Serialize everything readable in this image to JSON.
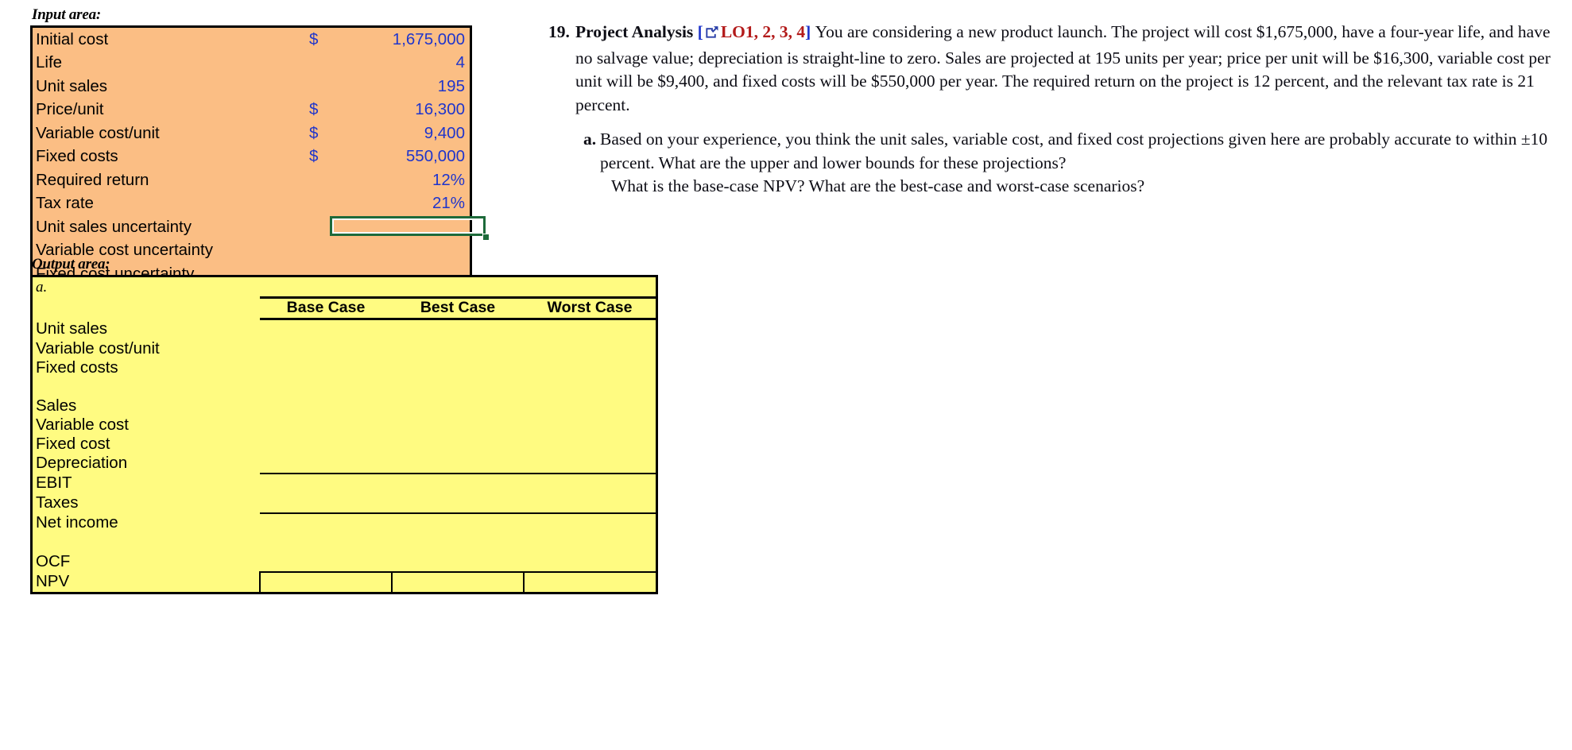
{
  "input_area": {
    "title": "Input area:",
    "fill_color": "#FBBE84",
    "value_color": "#1F35CC",
    "rows": [
      {
        "label": "Initial cost",
        "currency": "$",
        "value": "1,675,000"
      },
      {
        "label": "Life",
        "currency": "",
        "value": "4"
      },
      {
        "label": "Unit sales",
        "currency": "",
        "value": "195"
      },
      {
        "label": "Price/unit",
        "currency": "$",
        "value": "16,300"
      },
      {
        "label": "Variable cost/unit",
        "currency": "$",
        "value": "9,400"
      },
      {
        "label": "Fixed costs",
        "currency": "$",
        "value": "550,000"
      },
      {
        "label": "Required return",
        "currency": "",
        "value": "12%"
      },
      {
        "label": "Tax rate",
        "currency": "",
        "value": "21%"
      },
      {
        "label": "Unit sales uncertainty",
        "currency": "",
        "value": ""
      },
      {
        "label": "Variable cost uncertainty",
        "currency": "",
        "value": ""
      },
      {
        "label": "Fixed cost uncertainty",
        "currency": "",
        "value": ""
      }
    ],
    "selected_cell": {
      "row_label": "Unit sales uncertainty",
      "value": "",
      "border_color": "#1D6A3A"
    }
  },
  "output_area": {
    "title": "Output area:",
    "fill_color": "#FFFB81",
    "part_label": "a.",
    "columns": [
      "Base Case",
      "Best Case",
      "Worst Case"
    ],
    "rows": [
      {
        "label": "Unit sales",
        "values": [
          "",
          "",
          ""
        ],
        "style": "plain"
      },
      {
        "label": "Variable cost/unit",
        "values": [
          "",
          "",
          ""
        ],
        "style": "plain"
      },
      {
        "label": "Fixed costs",
        "values": [
          "",
          "",
          ""
        ],
        "style": "plain"
      },
      {
        "label": "",
        "values": [
          "",
          "",
          ""
        ],
        "style": "spacer"
      },
      {
        "label": "Sales",
        "values": [
          "",
          "",
          ""
        ],
        "style": "plain"
      },
      {
        "label": "Variable cost",
        "values": [
          "",
          "",
          ""
        ],
        "style": "plain"
      },
      {
        "label": "Fixed cost",
        "values": [
          "",
          "",
          ""
        ],
        "style": "plain"
      },
      {
        "label": "Depreciation",
        "values": [
          "",
          "",
          ""
        ],
        "style": "plain"
      },
      {
        "label": "EBIT",
        "values": [
          "",
          "",
          ""
        ],
        "style": "rule-above"
      },
      {
        "label": "Taxes",
        "values": [
          "",
          "",
          ""
        ],
        "style": "plain"
      },
      {
        "label": "Net income",
        "values": [
          "",
          "",
          ""
        ],
        "style": "rule-above"
      },
      {
        "label": "",
        "values": [
          "",
          "",
          ""
        ],
        "style": "spacer"
      },
      {
        "label": "OCF",
        "values": [
          "",
          "",
          ""
        ],
        "style": "plain"
      },
      {
        "label": "NPV",
        "values": [
          "",
          "",
          ""
        ],
        "style": "boxed"
      }
    ]
  },
  "question": {
    "number": "19.",
    "title": "Project Analysis",
    "bracket_open": "[",
    "icon": "excel-export-icon",
    "lo_tag": "LO1, 2, 3, 4",
    "bracket_close": "]",
    "body": "You are considering a new product launch. The project will cost $1,675,000, have a four-year life, and have no salvage value; depreciation is straight-line to zero. Sales are projected at 195 units per year; price per unit will be $16,300, variable cost per unit will be $9,400, and fixed costs will be $550,000 per year. The required return on the project is 12 percent, and the relevant tax rate is 21 percent.",
    "parts": [
      {
        "letter": "a.",
        "line1": "Based on your experience, you think the unit sales, variable cost, and fixed cost projections given here are probably accurate to within ±10 percent. What are the upper and lower bounds for these projections?",
        "line2": "What is the base-case NPV? What are the best-case and worst-case scenarios?"
      }
    ]
  }
}
